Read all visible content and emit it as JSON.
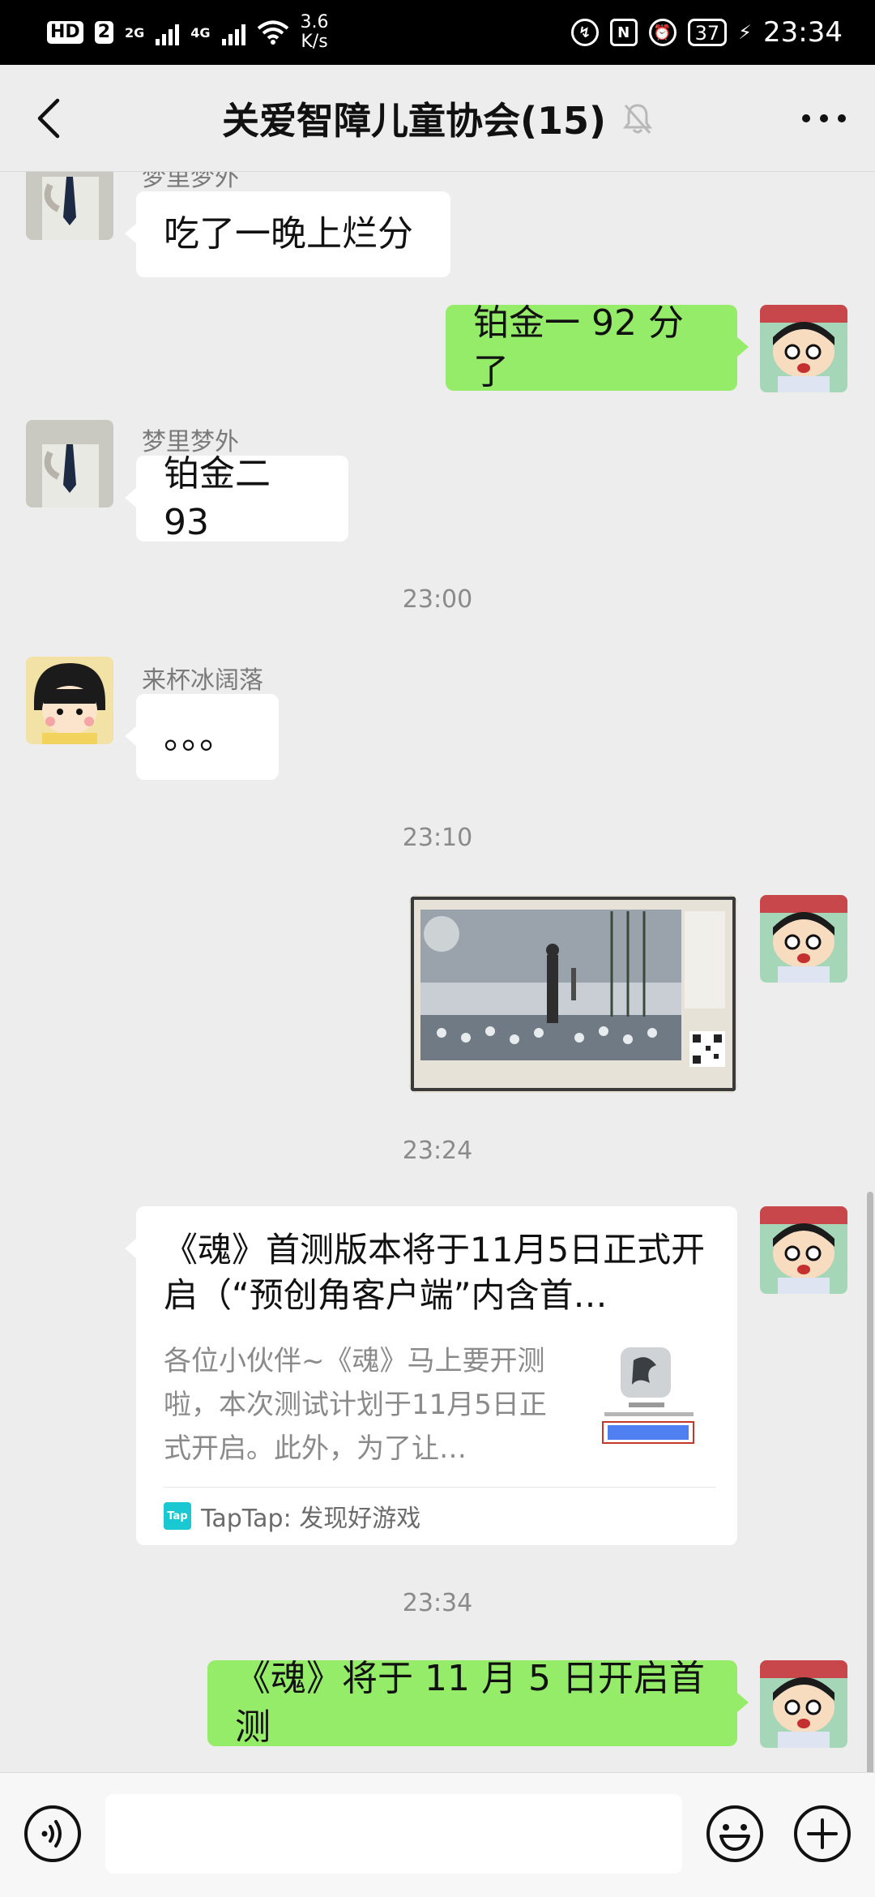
{
  "status_bar": {
    "hd_badge": "HD",
    "sim_badge": "2",
    "net1": "2G",
    "net2": "4G",
    "speed_value": "3.6",
    "speed_unit": "K/s",
    "battery": "37",
    "time": "23:34"
  },
  "header": {
    "title": "关爱智障儿童协会(15)"
  },
  "messages": {
    "m1": {
      "sender": "梦里梦外",
      "text": "吃了一晚上烂分"
    },
    "m2": {
      "text": "铂金一 92 分了"
    },
    "m3": {
      "sender": "梦里梦外",
      "text": "铂金二 93"
    },
    "t1": "23:00",
    "m4": {
      "sender": "来杯冰阔落",
      "text": "。。。"
    },
    "t2": "23:10",
    "t3": "23:24",
    "card": {
      "title": "《魂》首测版本将于11月5日正式开启（“预创角客户端”内含首…",
      "description": "各位小伙伴~《魂》马上要开测啦，本次测试计划于11月5日正式开启。此外，为了让…",
      "source": "TapTap: 发现好游戏",
      "logo_text": "Tap"
    },
    "t4": "23:34",
    "m5": {
      "text": "《魂》将于 11 月 5 日开启首测"
    }
  },
  "input": {
    "placeholder": ""
  }
}
